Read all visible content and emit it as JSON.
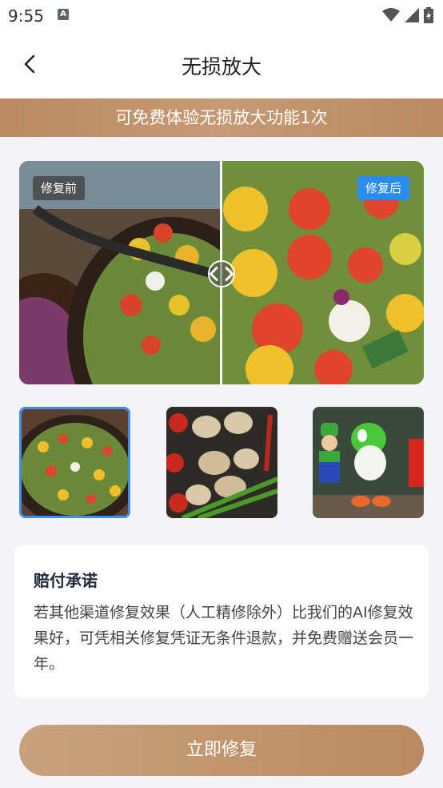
{
  "status_bar": {
    "time": "9:55",
    "icons": [
      "a-icon",
      "wifi-icon",
      "signal-icon",
      "battery-icon"
    ]
  },
  "header": {
    "title": "无损放大",
    "back_icon": "back-arrow-icon"
  },
  "banner": {
    "text": "可免费体验无损放大功能1次"
  },
  "compare": {
    "before_label": "修复前",
    "after_label": "修复后",
    "handle_icon": "compare-handle-icon",
    "after_tag_color": "#2a8cf0"
  },
  "samples": [
    {
      "name": "salad-sample",
      "selected": true
    },
    {
      "name": "mushroom-sample",
      "selected": false
    },
    {
      "name": "toy-figures-sample",
      "selected": false
    }
  ],
  "guarantee": {
    "title": "赔付承诺",
    "text": "若其他渠道修复效果（人工精修除外）比我们的AI修复效果好，可凭相关修复凭证无条件退款，并免费赠送会员一年。"
  },
  "cta": {
    "label": "立即修复"
  },
  "colors": {
    "accent_gold": "#b98a62",
    "selected_border": "#3d8fe8"
  }
}
